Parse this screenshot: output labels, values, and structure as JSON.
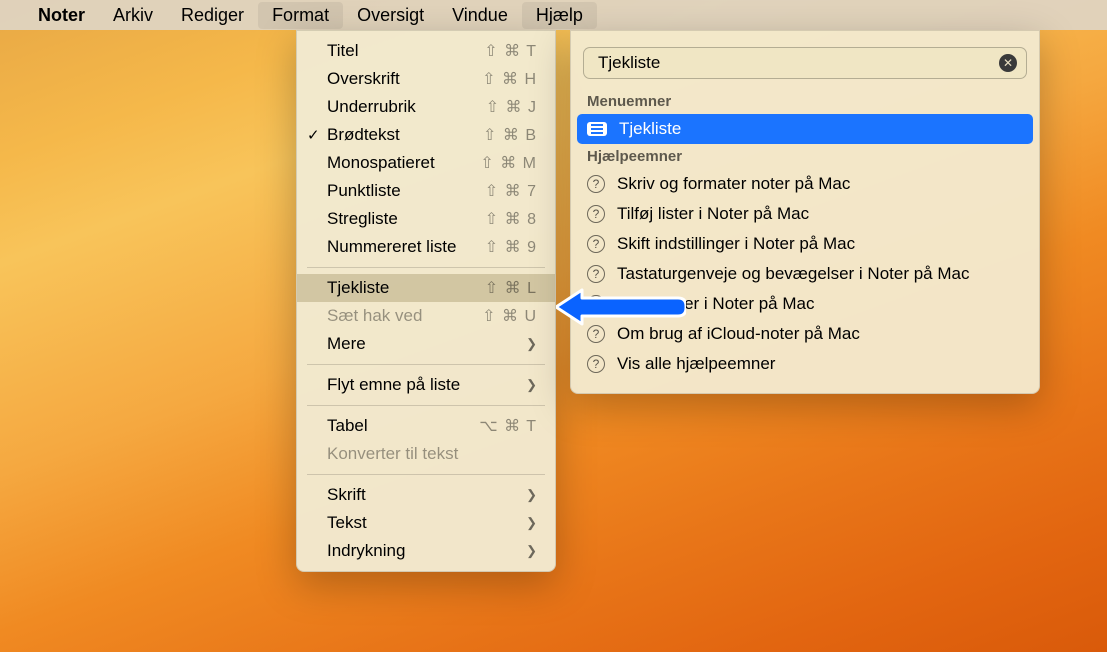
{
  "menubar": {
    "app": "Noter",
    "items": [
      "Arkiv",
      "Rediger",
      "Format",
      "Oversigt",
      "Vindue",
      "Hjælp"
    ],
    "open_index": 2
  },
  "format_menu": {
    "items": [
      {
        "label": "Titel",
        "shortcut": "⇧ ⌘ T"
      },
      {
        "label": "Overskrift",
        "shortcut": "⇧ ⌘ H"
      },
      {
        "label": "Underrubrik",
        "shortcut": "⇧ ⌘ J"
      },
      {
        "label": "Brødtekst",
        "shortcut": "⇧ ⌘ B",
        "checked": true
      },
      {
        "label": "Monospatieret",
        "shortcut": "⇧ ⌘ M"
      },
      {
        "label": "Punktliste",
        "shortcut": "⇧ ⌘ 7"
      },
      {
        "label": "Stregliste",
        "shortcut": "⇧ ⌘ 8"
      },
      {
        "label": "Nummereret liste",
        "shortcut": "⇧ ⌘ 9"
      }
    ],
    "checklist": {
      "label": "Tjekliste",
      "shortcut": "⇧ ⌘ L"
    },
    "mark_done": {
      "label": "Sæt hak ved",
      "shortcut": "⇧ ⌘ U",
      "disabled": true
    },
    "more": {
      "label": "Mere"
    },
    "move_list": {
      "label": "Flyt emne på liste"
    },
    "table": {
      "label": "Tabel",
      "shortcut": "⌥ ⌘ T"
    },
    "convert": {
      "label": "Konverter til tekst",
      "disabled": true
    },
    "bottom": [
      {
        "label": "Skrift"
      },
      {
        "label": "Tekst"
      },
      {
        "label": "Indrykning"
      }
    ]
  },
  "help_panel": {
    "search_value": "Tjekliste",
    "section_menu": "Menuemner",
    "selected_menu_item": "Tjekliste",
    "section_topics": "Hjælpeemner",
    "topics": [
      "Skriv og formater noter på Mac",
      "Tilføj lister i Noter på Mac",
      "Skift indstillinger i Noter på Mac",
      "Tastaturgenveje og bevægelser i Noter på Mac",
      "rte mapper i Noter på Mac",
      "Om brug af iCloud-noter på Mac",
      "Vis alle hjælpeemner"
    ]
  }
}
